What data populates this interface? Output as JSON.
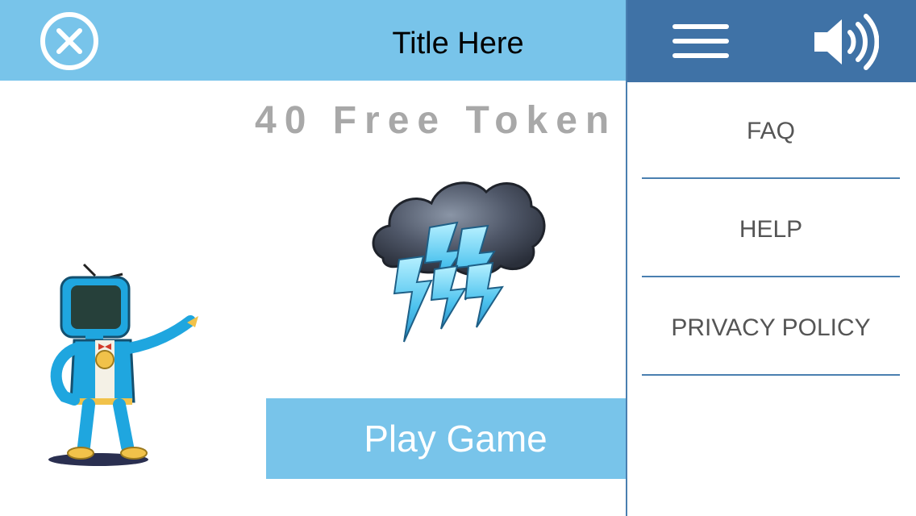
{
  "header": {
    "title": "Title Here",
    "close_icon": "close-circle-icon",
    "background": "#78c4ea"
  },
  "main": {
    "promo_text": "40 Free Token",
    "promo_color": "#a8a8a8",
    "hero_image": "storm-cloud-lightning",
    "mascot_image": "tv-head-robot-mascot",
    "play_button": {
      "label": "Play Game",
      "background": "#78c4ea"
    }
  },
  "drawer": {
    "header_background": "#3f72a6",
    "menu_icon": "hamburger-menu-icon",
    "sound_icon": "speaker-volume-icon",
    "items": [
      {
        "label": "FAQ"
      },
      {
        "label": "HELP"
      },
      {
        "label": "PRIVACY POLICY"
      }
    ],
    "divider_color": "#4a7fb0"
  }
}
